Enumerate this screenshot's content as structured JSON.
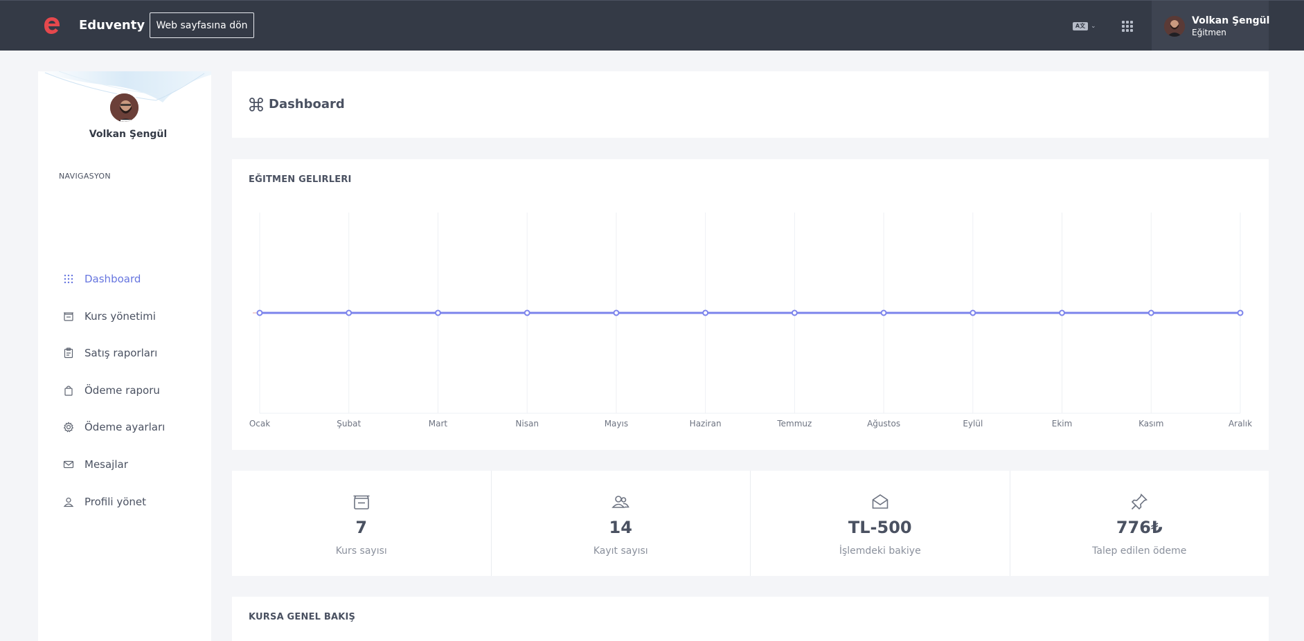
{
  "header": {
    "brand": "Eduventy",
    "back_button": "Web sayfasına dön",
    "language_icon": "language-icon",
    "apps_icon": "apps-grid-icon",
    "user": {
      "name": "Volkan Şengül",
      "role": "Eğitmen"
    }
  },
  "sidebar": {
    "user_name": "Volkan Şengül",
    "nav_heading": "NAVIGASYON",
    "items": [
      {
        "label": "Dashboard",
        "icon": "grid-icon",
        "active": true
      },
      {
        "label": "Kurs yönetimi",
        "icon": "inbox-icon",
        "active": false
      },
      {
        "label": "Satış raporları",
        "icon": "clipboard-icon",
        "active": false
      },
      {
        "label": "Ödeme raporu",
        "icon": "bag-icon",
        "active": false
      },
      {
        "label": "Ödeme ayarları",
        "icon": "gear-icon",
        "active": false
      },
      {
        "label": "Mesajlar",
        "icon": "mail-icon",
        "active": false
      },
      {
        "label": "Profili yönet",
        "icon": "user-icon",
        "active": false
      }
    ]
  },
  "page": {
    "title": "Dashboard",
    "title_icon": "command-icon"
  },
  "earnings": {
    "title": "EĞITMEN GELIRLERI"
  },
  "chart_data": {
    "type": "line",
    "categories": [
      "Ocak",
      "Şubat",
      "Mart",
      "Nisan",
      "Mayıs",
      "Haziran",
      "Temmuz",
      "Ağustos",
      "Eylül",
      "Ekim",
      "Kasım",
      "Aralık"
    ],
    "values": [
      0,
      0,
      0,
      0,
      0,
      0,
      0,
      0,
      0,
      0,
      0,
      0
    ],
    "xlabel": "",
    "ylabel": "",
    "grid": true,
    "color": "#7b83eb"
  },
  "stats": [
    {
      "value": "7",
      "label": "Kurs sayısı",
      "icon": "inbox-icon"
    },
    {
      "value": "14",
      "label": "Kayıt sayısı",
      "icon": "users-icon"
    },
    {
      "value": "TL-500",
      "label": "İşlemdeki bakiye",
      "icon": "open-envelope-icon"
    },
    {
      "value": "776₺",
      "label": "Talep edilen ödeme",
      "icon": "pin-icon"
    }
  ],
  "overview": {
    "title": "KURSA GENEL BAKIŞ"
  },
  "colors": {
    "accent": "#6675df",
    "topbar": "#343a46",
    "brand": "#e5484d",
    "line": "#7b83eb"
  }
}
